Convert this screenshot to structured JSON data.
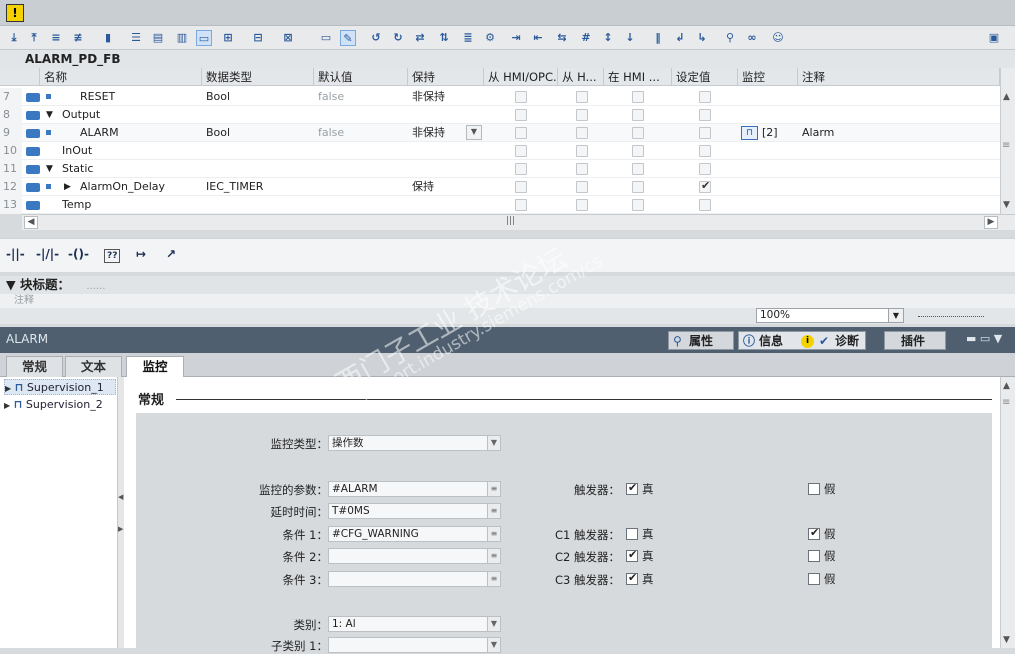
{
  "warning_icon": "warning-icon",
  "block_name": "ALARM_PD_FB",
  "table": {
    "columns": [
      "名称",
      "数据类型",
      "默认值",
      "保持",
      "从 HMI/OPC...",
      "从 H...",
      "在 HMI ...",
      "设定值",
      "监控",
      "注释"
    ],
    "rows": [
      {
        "num": "7",
        "name": "RESET",
        "type": "Bool",
        "default": "false",
        "retain": "非保持",
        "monitor": "",
        "comment": ""
      },
      {
        "num": "8",
        "name": "Output",
        "type": "",
        "default": "",
        "retain": "",
        "monitor": "",
        "comment": ""
      },
      {
        "num": "9",
        "name": "ALARM",
        "type": "Bool",
        "default": "false",
        "retain": "非保持",
        "monitor": "[2]",
        "comment": "Alarm"
      },
      {
        "num": "10",
        "name": "InOut",
        "type": "",
        "default": "",
        "retain": "",
        "monitor": "",
        "comment": ""
      },
      {
        "num": "11",
        "name": "Static",
        "type": "",
        "default": "",
        "retain": "",
        "monitor": "",
        "comment": ""
      },
      {
        "num": "12",
        "name": "AlarmOn_Delay",
        "type": "IEC_TIMER",
        "default": "",
        "retain": "保持",
        "monitor": "",
        "comment": ""
      },
      {
        "num": "13",
        "name": "Temp",
        "type": "",
        "default": "",
        "retain": "",
        "monitor": "",
        "comment": ""
      }
    ]
  },
  "ladder": {
    "items": [
      "-||-",
      "-|/|-",
      "-()-",
      "??",
      "↦",
      "↗"
    ]
  },
  "block_title": {
    "label": "块标题：",
    "placeholder": "......"
  },
  "comment_label": "注释",
  "zoom": "100%",
  "inspector": {
    "title": "ALARM",
    "tabs": {
      "properties": "属性",
      "info": "信息",
      "diagnostics": "诊断",
      "plugins": "插件"
    }
  },
  "inner_tabs": [
    "常规",
    "文本",
    "监控"
  ],
  "tree": [
    "Supervision_1",
    "Supervision_2"
  ],
  "section": "常规",
  "form": {
    "monitor_type_label": "监控类型：",
    "monitor_type_value": "操作数",
    "param_label": "监控的参数：",
    "param_value": "#ALARM",
    "delay_label": "延时时间：",
    "delay_value": "T#0MS",
    "cond1_label": "条件 1：",
    "cond1_value": "#CFG_WARNING",
    "cond2_label": "条件 2：",
    "cond2_value": "",
    "cond3_label": "条件 3：",
    "cond3_value": "",
    "category_label": "类别：",
    "category_value": "1: Al",
    "subcategory_label": "子类别 1：",
    "trigger_label": "触发器：",
    "c1_trigger_label": "C1 触发器：",
    "c2_trigger_label": "C2 触发器：",
    "c3_trigger_label": "C3 触发器：",
    "true_label": "真",
    "false_label": "假"
  },
  "watermark": {
    "line1": "西门子工业  技术论坛",
    "line2": "support.industry.siemens.com/cs"
  }
}
